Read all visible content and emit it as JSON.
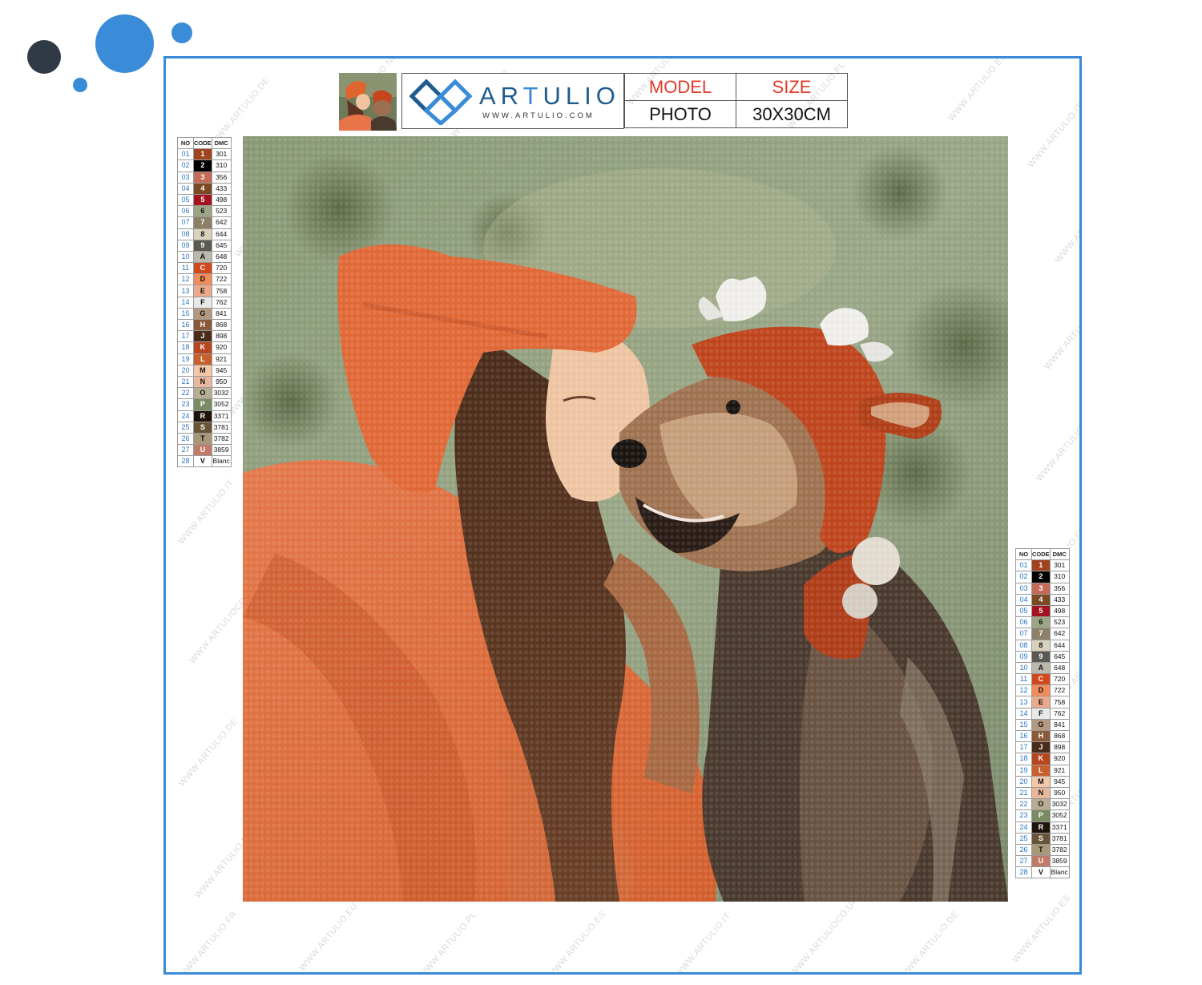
{
  "brand": {
    "name_pre": "AR",
    "name_accent": "T",
    "name_post": "ULIO",
    "url": "WWW.ARTULIO.COM"
  },
  "spec": {
    "model_label": "MODEL",
    "size_label": "SIZE",
    "model_value": "PHOTO",
    "size_value": "30X30CM"
  },
  "legend_headers": {
    "no": "NO",
    "code": "CODE",
    "dmc": "DMC"
  },
  "legend": [
    {
      "no": "01",
      "code": "1",
      "dmc": "301",
      "color": "#a0431f"
    },
    {
      "no": "02",
      "code": "2",
      "dmc": "310",
      "color": "#000000"
    },
    {
      "no": "03",
      "code": "3",
      "dmc": "356",
      "color": "#c46a58"
    },
    {
      "no": "04",
      "code": "4",
      "dmc": "433",
      "color": "#7a4a24"
    },
    {
      "no": "05",
      "code": "5",
      "dmc": "498",
      "color": "#a3121f"
    },
    {
      "no": "06",
      "code": "6",
      "dmc": "523",
      "color": "#9aa684"
    },
    {
      "no": "07",
      "code": "7",
      "dmc": "642",
      "color": "#8c8068"
    },
    {
      "no": "08",
      "code": "8",
      "dmc": "644",
      "color": "#d8d2bc"
    },
    {
      "no": "09",
      "code": "9",
      "dmc": "645",
      "color": "#5b5a52"
    },
    {
      "no": "10",
      "code": "A",
      "dmc": "648",
      "color": "#bcb8ae"
    },
    {
      "no": "11",
      "code": "C",
      "dmc": "720",
      "color": "#d0481c"
    },
    {
      "no": "12",
      "code": "D",
      "dmc": "722",
      "color": "#f28c5a"
    },
    {
      "no": "13",
      "code": "E",
      "dmc": "758",
      "color": "#eaa98c"
    },
    {
      "no": "14",
      "code": "F",
      "dmc": "762",
      "color": "#e8e8e8"
    },
    {
      "no": "15",
      "code": "G",
      "dmc": "841",
      "color": "#b49880"
    },
    {
      "no": "16",
      "code": "H",
      "dmc": "868",
      "color": "#8a5a38"
    },
    {
      "no": "17",
      "code": "J",
      "dmc": "898",
      "color": "#4a2c1a"
    },
    {
      "no": "18",
      "code": "K",
      "dmc": "920",
      "color": "#b5461e"
    },
    {
      "no": "19",
      "code": "L",
      "dmc": "921",
      "color": "#c8602e"
    },
    {
      "no": "20",
      "code": "M",
      "dmc": "945",
      "color": "#f2c8a8"
    },
    {
      "no": "21",
      "code": "N",
      "dmc": "950",
      "color": "#e8b89c"
    },
    {
      "no": "22",
      "code": "O",
      "dmc": "3032",
      "color": "#b8ac92"
    },
    {
      "no": "23",
      "code": "P",
      "dmc": "3052",
      "color": "#7a8a62"
    },
    {
      "no": "24",
      "code": "R",
      "dmc": "3371",
      "color": "#1e140c"
    },
    {
      "no": "25",
      "code": "S",
      "dmc": "3781",
      "color": "#6a5438"
    },
    {
      "no": "26",
      "code": "T",
      "dmc": "3782",
      "color": "#a89878"
    },
    {
      "no": "27",
      "code": "U",
      "dmc": "3859",
      "color": "#c07a6a"
    },
    {
      "no": "28",
      "code": "V",
      "dmc": "Blanc",
      "color": "#ffffff"
    }
  ],
  "watermarks": [
    "WWW.ARTULIO.DE",
    "WWW.ARTULIO.NL",
    "WWW.ARTULIO.FR",
    "WWW.ARTULIO.EU",
    "WWW.ARTULIO.PL",
    "WWW.ARTULIO.ES",
    "WWW.ARTULIO.IT",
    "WWW.ARTULIOCO.UK"
  ],
  "colors": {
    "frame": "#3a8bd8",
    "accent": "#e23a2a"
  }
}
